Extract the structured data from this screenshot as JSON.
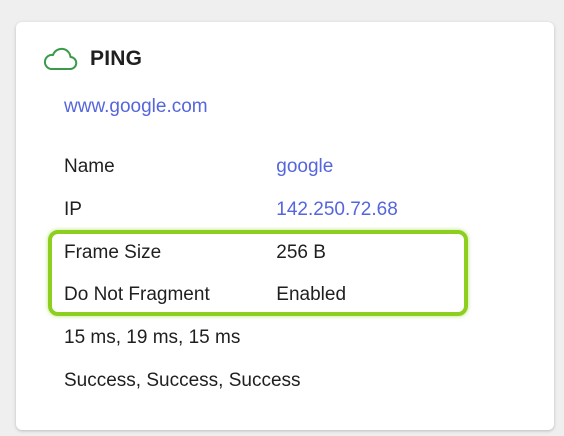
{
  "card": {
    "title": "PING",
    "icon": "cloud-icon",
    "accent_color": "#3a9a4a",
    "host": "www.google.com",
    "rows": {
      "name": {
        "label": "Name",
        "value": "google"
      },
      "ip": {
        "label": "IP",
        "value": "142.250.72.68"
      },
      "frame_size": {
        "label": "Frame Size",
        "value": "256 B"
      },
      "do_not_fragment": {
        "label": "Do Not Fragment",
        "value": "Enabled"
      }
    },
    "times": "15 ms, 19 ms, 15 ms",
    "statuses": "Success, Success, Success"
  },
  "colors": {
    "link": "#5566dd",
    "highlight": "#8dcf1e"
  }
}
